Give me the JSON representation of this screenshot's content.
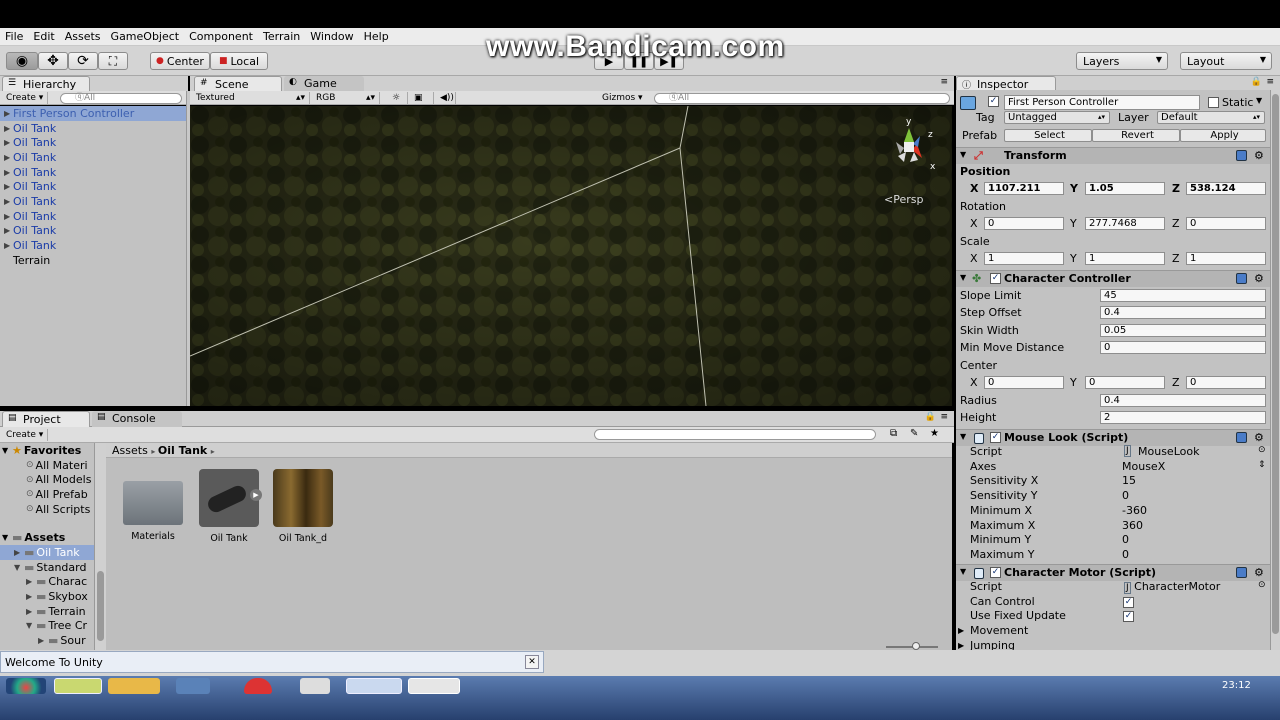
{
  "watermark": "www.Bandicam.com",
  "menu": [
    "File",
    "Edit",
    "Assets",
    "GameObject",
    "Component",
    "Terrain",
    "Window",
    "Help"
  ],
  "toolbar": {
    "pivot": "Center",
    "space": "Local",
    "layers": "Layers",
    "layout": "Layout"
  },
  "hierarchy": {
    "tab": "Hierarchy",
    "create": "Create",
    "search": "ⓠAll",
    "items": [
      {
        "label": "First Person Controller",
        "selected": true
      },
      {
        "label": "Oil Tank"
      },
      {
        "label": "Oil Tank"
      },
      {
        "label": "Oil Tank"
      },
      {
        "label": "Oil Tank"
      },
      {
        "label": "Oil Tank"
      },
      {
        "label": "Oil Tank"
      },
      {
        "label": "Oil Tank"
      },
      {
        "label": "Oil Tank"
      },
      {
        "label": "Oil Tank"
      }
    ],
    "terrain": "Terrain"
  },
  "scene": {
    "tab_scene": "Scene",
    "tab_game": "Game",
    "render_mode": "Textured",
    "color_mode": "RGB",
    "gizmos": "Gizmos",
    "search": "ⓠAll",
    "persp": "<Persp",
    "axis_y": "y",
    "axis_x": "x",
    "axis_z": "z"
  },
  "project": {
    "tab_project": "Project",
    "tab_console": "Console",
    "create": "Create",
    "favorites": "Favorites",
    "fav_items": [
      "All Materi",
      "All Models",
      "All Prefab",
      "All Scripts"
    ],
    "assets_label": "Assets",
    "tree": [
      {
        "label": "Oil Tank",
        "indent": 1,
        "selected": true
      },
      {
        "label": "Standard",
        "indent": 1
      },
      {
        "label": "Charac",
        "indent": 2
      },
      {
        "label": "Skybox",
        "indent": 2
      },
      {
        "label": "Terrain",
        "indent": 2
      },
      {
        "label": "Tree Cr",
        "indent": 2
      },
      {
        "label": "Sour",
        "indent": 3
      }
    ],
    "breadcrumb_root": "Assets",
    "breadcrumb_current": "Oil Tank",
    "assets": [
      {
        "label": "Materials"
      },
      {
        "label": "Oil Tank"
      },
      {
        "label": "Oil Tank_d"
      }
    ]
  },
  "welcome": "Welcome To Unity",
  "clock": "23:12",
  "inspector": {
    "tab": "Inspector",
    "name": "First Person Controller",
    "static": "Static",
    "tag_label": "Tag",
    "tag": "Untagged",
    "layer_label": "Layer",
    "layer": "Default",
    "prefab_label": "Prefab",
    "select": "Select",
    "revert": "Revert",
    "apply": "Apply",
    "transform": {
      "title": "Transform",
      "position_label": "Position",
      "pos": {
        "x": "1107.211",
        "y": "1.05",
        "z": "538.124"
      },
      "rotation_label": "Rotation",
      "rot": {
        "x": "0",
        "y": "277.7468",
        "z": "0"
      },
      "scale_label": "Scale",
      "scale": {
        "x": "1",
        "y": "1",
        "z": "1"
      }
    },
    "cc": {
      "title": "Character Controller",
      "slope_label": "Slope Limit",
      "slope": "45",
      "step_label": "Step Offset",
      "step": "0.4",
      "skin_label": "Skin Width",
      "skin": "0.05",
      "minmove_label": "Min Move Distance",
      "minmove": "0",
      "center_label": "Center",
      "center": {
        "x": "0",
        "y": "0",
        "z": "0"
      },
      "radius_label": "Radius",
      "radius": "0.4",
      "height_label": "Height",
      "height": "2"
    },
    "mouselook": {
      "title": "Mouse Look (Script)",
      "rows": [
        {
          "label": "Script",
          "value": "MouseLook"
        },
        {
          "label": "Axes",
          "value": "MouseX"
        },
        {
          "label": "Sensitivity X",
          "value": "15"
        },
        {
          "label": "Sensitivity Y",
          "value": "0"
        },
        {
          "label": "Minimum X",
          "value": "-360"
        },
        {
          "label": "Maximum X",
          "value": "360"
        },
        {
          "label": "Minimum Y",
          "value": "0"
        },
        {
          "label": "Maximum Y",
          "value": "0"
        }
      ]
    },
    "motor": {
      "title": "Character Motor (Script)",
      "script_label": "Script",
      "script": "CharacterMotor",
      "can_control": "Can Control",
      "fixed_update": "Use Fixed Update",
      "movement": "Movement",
      "jumping": "Jumping"
    },
    "axis_labels": {
      "x": "X",
      "y": "Y",
      "z": "Z"
    }
  }
}
